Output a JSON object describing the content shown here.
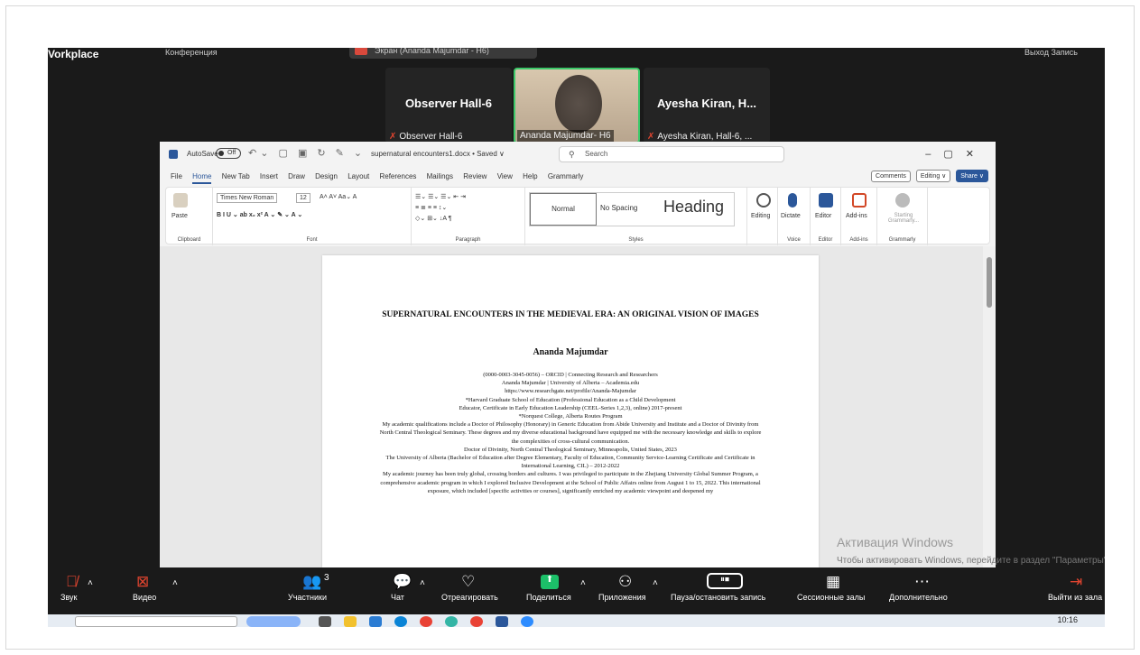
{
  "top_bar": {
    "workplace": "Vorkplace",
    "conference": "Конференция",
    "share_label": "Экран (Ananda Majumdar - H6)",
    "right_label": "Выход     Запись"
  },
  "tiles": [
    {
      "name": "Observer Hall-6",
      "caption": "Observer Hall-6"
    },
    {
      "name": "",
      "caption": "Ananda Majumdar- H6"
    },
    {
      "name": "Ayesha Kiran, H...",
      "caption": "Ayesha Kiran, Hall-6, ..."
    }
  ],
  "word": {
    "autosave": "AutoSave",
    "toggle": "Off",
    "doc_title": "supernatural encounters1.docx • Saved ∨",
    "search": "Search",
    "menu_tabs": [
      "File",
      "Home",
      "New Tab",
      "Insert",
      "Draw",
      "Design",
      "Layout",
      "References",
      "Mailings",
      "Review",
      "View",
      "Help",
      "Grammarly"
    ],
    "comments": "Comments",
    "editing": "Editing ∨",
    "share": "Share ∨",
    "ribbon": {
      "paste": "Paste",
      "clipboard": "Clipboard",
      "font_name": "Times New Roman",
      "font_size": "12",
      "font": "Font",
      "paragraph": "Paragraph",
      "styles": "Styles",
      "style_normal": "Normal",
      "style_nospacing": "No Spacing",
      "style_heading": "Heading",
      "editing": "Editing",
      "dictate": "Dictate",
      "voice": "Voice",
      "editor": "Editor",
      "addins": "Add-ins",
      "grammarly_btn": "Starting Grammarly...",
      "grammarly": "Grammarly"
    },
    "page": {
      "title": "SUPERNATURAL ENCOUNTERS IN THE MEDIEVAL ERA: AN ORIGINAL VISION OF IMAGES",
      "author": "Ananda Majumdar",
      "lines": [
        "(0000-0003-3045-0056) – ORCID | Connecting Research and Researchers",
        "Ananda Majumdar | University of Alberta – Academia.edu",
        "https://www.researchgate.net/profile/Ananda-Majumdar",
        "*Harvard Graduate School of Education (Professional Education as a Child Development",
        "Educator, Certificate in Early Education Leadership (CEEL-Series 1,2,3), online) 2017-present",
        "*Norquest College, Alberta Routes Program",
        "My academic qualifications include a Doctor of Philosophy (Honorary) in Generic Education from Abide University and Institute and a Doctor of Divinity from North Central Theological Seminary. These degrees and my diverse educational background have equipped me with the necessary knowledge and skills to explore the complexities of cross-cultural communication.",
        "Doctor of Divinity, North Central Theological Seminary, Minneapolis, United States, 2023",
        "The University of Alberta (Bachelor of Education after Degree Elementary, Faculty of Education, Community Service-Learning Certificate and Certificate in International Learning, CIL) – 2012-2022",
        "My academic journey has been truly global, crossing borders and cultures. I was privileged to participate in the Zhejiang University Global Summer Program, a comprehensive academic program in which I explored Inclusive Development at the School of Public Affairs online from August 1 to 15, 2022. This international exposure, which included [specific activities or courses], significantly enriched my academic viewpoint and deepened my"
      ]
    }
  },
  "watermark": {
    "title": "Активация Windows",
    "subtitle": "Чтобы активировать Windows, перейдите в раздел \"Параметры\"."
  },
  "zoom_toolbar": {
    "sound": "Звук",
    "video": "Видео",
    "participants_count": "3",
    "participants": "Участники",
    "chat": "Чат",
    "react": "Отреагировать",
    "share": "Поделиться",
    "apps": "Приложения",
    "pause": "Пауза/остановить запись",
    "sessions": "Сессионные залы",
    "more": "Дополнительно",
    "leave": "Выйти из зала"
  },
  "taskbar": {
    "clock": "10:16"
  }
}
